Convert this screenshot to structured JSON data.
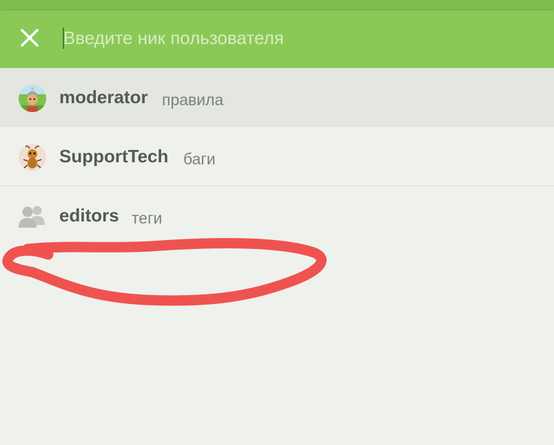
{
  "search": {
    "placeholder": "Введите ник пользователя",
    "value": ""
  },
  "icons": {
    "close": "close-icon",
    "group": "group-icon"
  },
  "colors": {
    "header": "#8bc957",
    "background": "#eff1ed",
    "active_row": "#e4e7e1",
    "annotation": "#ef5350"
  },
  "suggestions": [
    {
      "name": "moderator",
      "description": "правила",
      "avatar": "knight-avatar",
      "highlighted": true
    },
    {
      "name": "SupportTech",
      "description": "баги",
      "avatar": "ant-avatar",
      "highlighted": false
    },
    {
      "name": "editors",
      "description": "теги",
      "avatar": "group-icon",
      "highlighted": false
    }
  ]
}
